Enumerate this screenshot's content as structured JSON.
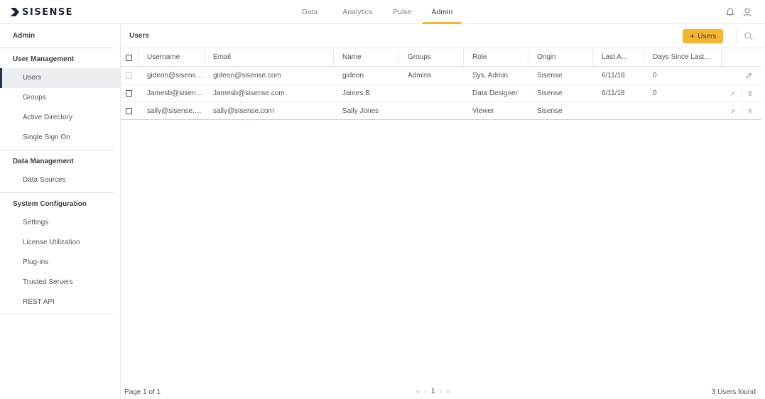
{
  "app": {
    "logo_text": "SISENSE"
  },
  "nav": {
    "tabs": [
      {
        "label": "Data"
      },
      {
        "label": "Analytics"
      },
      {
        "label": "Pulse"
      },
      {
        "label": "Admin",
        "active": true
      }
    ]
  },
  "top_icons": [
    "bell-icon",
    "user-icon"
  ],
  "sidebar": {
    "title": "Admin",
    "sections": [
      {
        "header": "User Management",
        "items": [
          "Users",
          "Groups",
          "Active Directory",
          "Single Sign On"
        ]
      },
      {
        "header": "Data Management",
        "items": [
          "Data Sources"
        ]
      },
      {
        "header": "System Configuration",
        "items": [
          "Settings",
          "License Utilization",
          "Plug-ins",
          "Trusted Servers",
          "REST API"
        ]
      }
    ],
    "active_item": "Users"
  },
  "main": {
    "title": "Users",
    "add_button": {
      "icon": "+",
      "label": "Users"
    }
  },
  "table": {
    "columns": [
      "Username",
      "Email",
      "Name",
      "Groups",
      "Role",
      "Origin",
      "Last A...",
      "Days Since Last..."
    ],
    "rows": [
      {
        "username": "gideon@sisense....",
        "email": "gideon@sisense.com",
        "name": "gideon",
        "groups": "Admins",
        "role": "Sys. Admin",
        "origin": "Sisense",
        "last": "6/11/18",
        "days": "0",
        "checkbox_disabled": true,
        "deletable": false
      },
      {
        "username": "Jamesb@sisense...",
        "email": "Jamesb@sisense.com",
        "name": "James B",
        "groups": "",
        "role": "Data Designer",
        "origin": "Sisense",
        "last": "6/11/18",
        "days": "0",
        "checkbox_disabled": false,
        "deletable": true
      },
      {
        "username": "sally@sisense.com",
        "email": "sally@sisense.com",
        "name": "Sally Jones",
        "groups": "",
        "role": "Viewer",
        "origin": "Sisense",
        "last": "",
        "days": "",
        "checkbox_disabled": false,
        "deletable": true
      }
    ]
  },
  "footer": {
    "page_info": "Page 1 of 1",
    "current_page": "1",
    "count": "3 Users found"
  },
  "colors": {
    "accent": "#f7b52c",
    "sidebar_active_marker": "#22344d",
    "logo": "#1b2330"
  }
}
